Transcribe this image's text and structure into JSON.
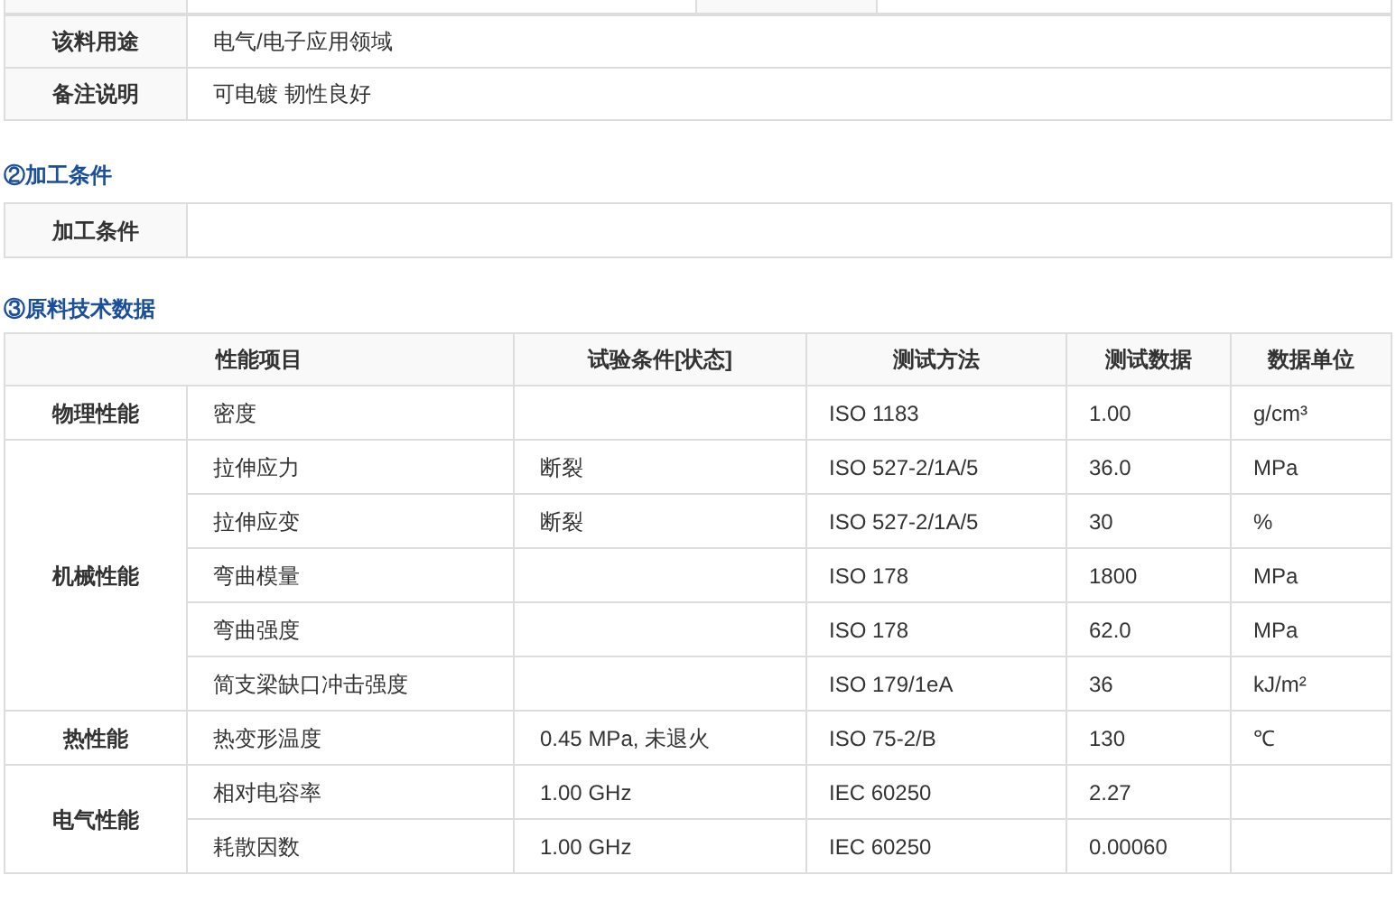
{
  "info_table": {
    "rows": [
      {
        "label": "该料用途",
        "value": "电气/电子应用领域"
      },
      {
        "label": "备注说明",
        "value": "可电镀 韧性良好"
      }
    ]
  },
  "processing": {
    "heading": "②加工条件",
    "rows": [
      {
        "label": "加工条件"
      }
    ]
  },
  "tech_data": {
    "heading": "③原料技术数据",
    "columns": [
      "性能项目",
      "试验条件[状态]",
      "测试方法",
      "测试数据",
      "数据单位"
    ],
    "groups": [
      {
        "label": "物理性能",
        "rows": [
          {
            "item": "密度",
            "method": "ISO 1183",
            "value": "1.00",
            "unit": "g/cm³"
          }
        ]
      },
      {
        "label": "机械性能",
        "rows": [
          {
            "item": "拉伸应力",
            "condition": "断裂",
            "method": "ISO 527-2/1A/5",
            "value": "36.0",
            "unit": "MPa"
          },
          {
            "item": "拉伸应变",
            "condition": "断裂",
            "method": "ISO 527-2/1A/5",
            "value": "30",
            "unit": "%"
          },
          {
            "item": "弯曲模量",
            "method": "ISO 178",
            "value": "1800",
            "unit": "MPa"
          },
          {
            "item": "弯曲强度",
            "method": "ISO 178",
            "value": "62.0",
            "unit": "MPa"
          },
          {
            "item": "简支梁缺口冲击强度",
            "method": "ISO 179/1eA",
            "value": "36",
            "unit": "kJ/m²"
          }
        ]
      },
      {
        "label": "热性能",
        "rows": [
          {
            "item": "热变形温度",
            "condition": "0.45 MPa, 未退火",
            "method": "ISO 75-2/B",
            "value": "130",
            "unit": "℃"
          }
        ]
      },
      {
        "label": "电气性能",
        "rows": [
          {
            "item": "相对电容率",
            "condition": "1.00 GHz",
            "method": "IEC 60250",
            "value": "2.27"
          },
          {
            "item": "耗散因数",
            "condition": "1.00 GHz",
            "method": "IEC 60250",
            "value": "0.00060"
          }
        ]
      }
    ]
  }
}
